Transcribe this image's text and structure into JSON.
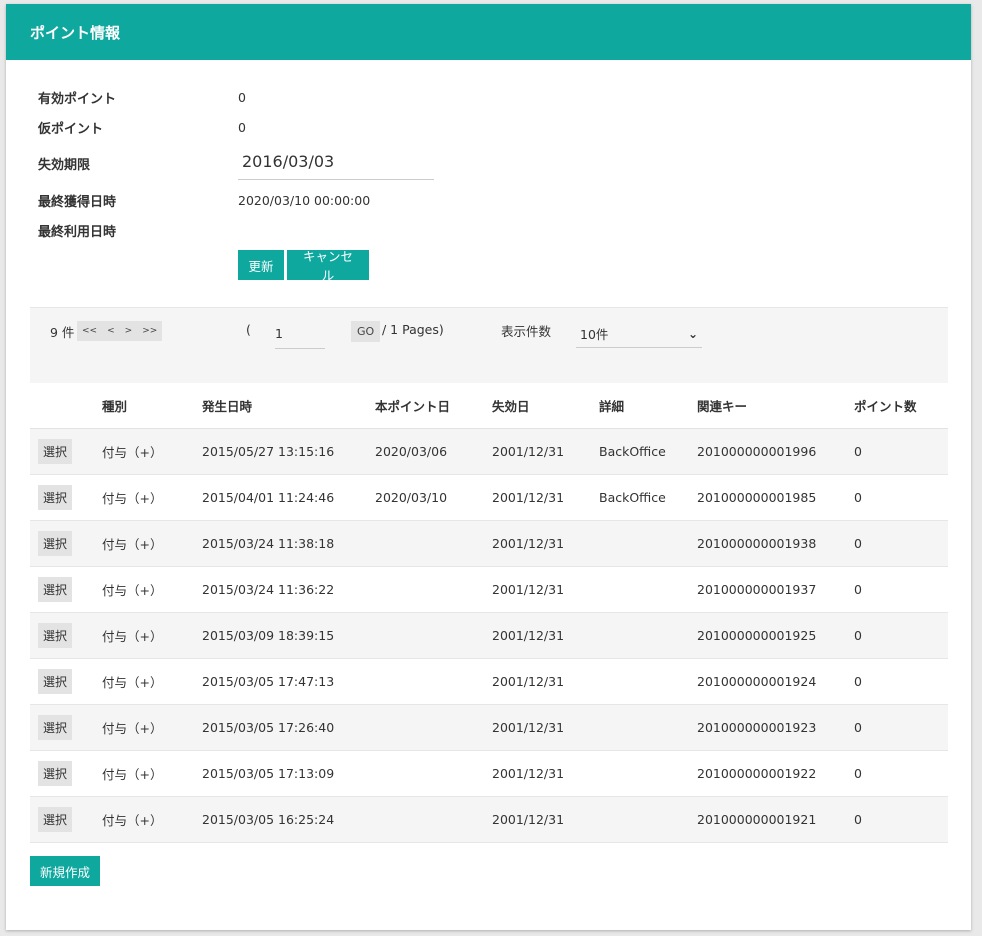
{
  "header": {
    "title": "ポイント情報"
  },
  "info": {
    "valid_points": {
      "label": "有効ポイント",
      "value": "0"
    },
    "provisional_points": {
      "label": "仮ポイント",
      "value": "0"
    },
    "expiry": {
      "label": "失効期限",
      "value": "2016/03/03"
    },
    "last_earned": {
      "label": "最終獲得日時",
      "value": "2020/03/10 00:00:00"
    },
    "last_used": {
      "label": "最終利用日時",
      "value": ""
    }
  },
  "actions": {
    "update": "更新",
    "cancel": "キャンセル"
  },
  "pager": {
    "count": "9 件",
    "first": "<<",
    "prev": "<",
    "next": ">",
    "last": ">>",
    "paren": "(",
    "page": "1",
    "go": "GO",
    "pages": "/ 1 Pages)",
    "per_page_label": "表示件数",
    "per_page_value": "10件"
  },
  "table": {
    "columns": [
      "",
      "種別",
      "発生日時",
      "本ポイント日",
      "失効日",
      "詳細",
      "関連キー",
      "ポイント数"
    ],
    "select_label": "選択",
    "rows": [
      [
        "付与（+）",
        "2015/05/27 13:15:16",
        "2020/03/06",
        "2001/12/31",
        "BackOffice",
        "201000000001996",
        "0"
      ],
      [
        "付与（+）",
        "2015/04/01 11:24:46",
        "2020/03/10",
        "2001/12/31",
        "BackOffice",
        "201000000001985",
        "0"
      ],
      [
        "付与（+）",
        "2015/03/24 11:38:18",
        "",
        "2001/12/31",
        "",
        "201000000001938",
        "0"
      ],
      [
        "付与（+）",
        "2015/03/24 11:36:22",
        "",
        "2001/12/31",
        "",
        "201000000001937",
        "0"
      ],
      [
        "付与（+）",
        "2015/03/09 18:39:15",
        "",
        "2001/12/31",
        "",
        "201000000001925",
        "0"
      ],
      [
        "付与（+）",
        "2015/03/05 17:47:13",
        "",
        "2001/12/31",
        "",
        "201000000001924",
        "0"
      ],
      [
        "付与（+）",
        "2015/03/05 17:26:40",
        "",
        "2001/12/31",
        "",
        "201000000001923",
        "0"
      ],
      [
        "付与（+）",
        "2015/03/05 17:13:09",
        "",
        "2001/12/31",
        "",
        "201000000001922",
        "0"
      ],
      [
        "付与（+）",
        "2015/03/05 16:25:24",
        "",
        "2001/12/31",
        "",
        "201000000001921",
        "0"
      ]
    ]
  },
  "footer": {
    "new_button": "新規作成"
  },
  "colors": {
    "accent": "#0ea89f"
  }
}
